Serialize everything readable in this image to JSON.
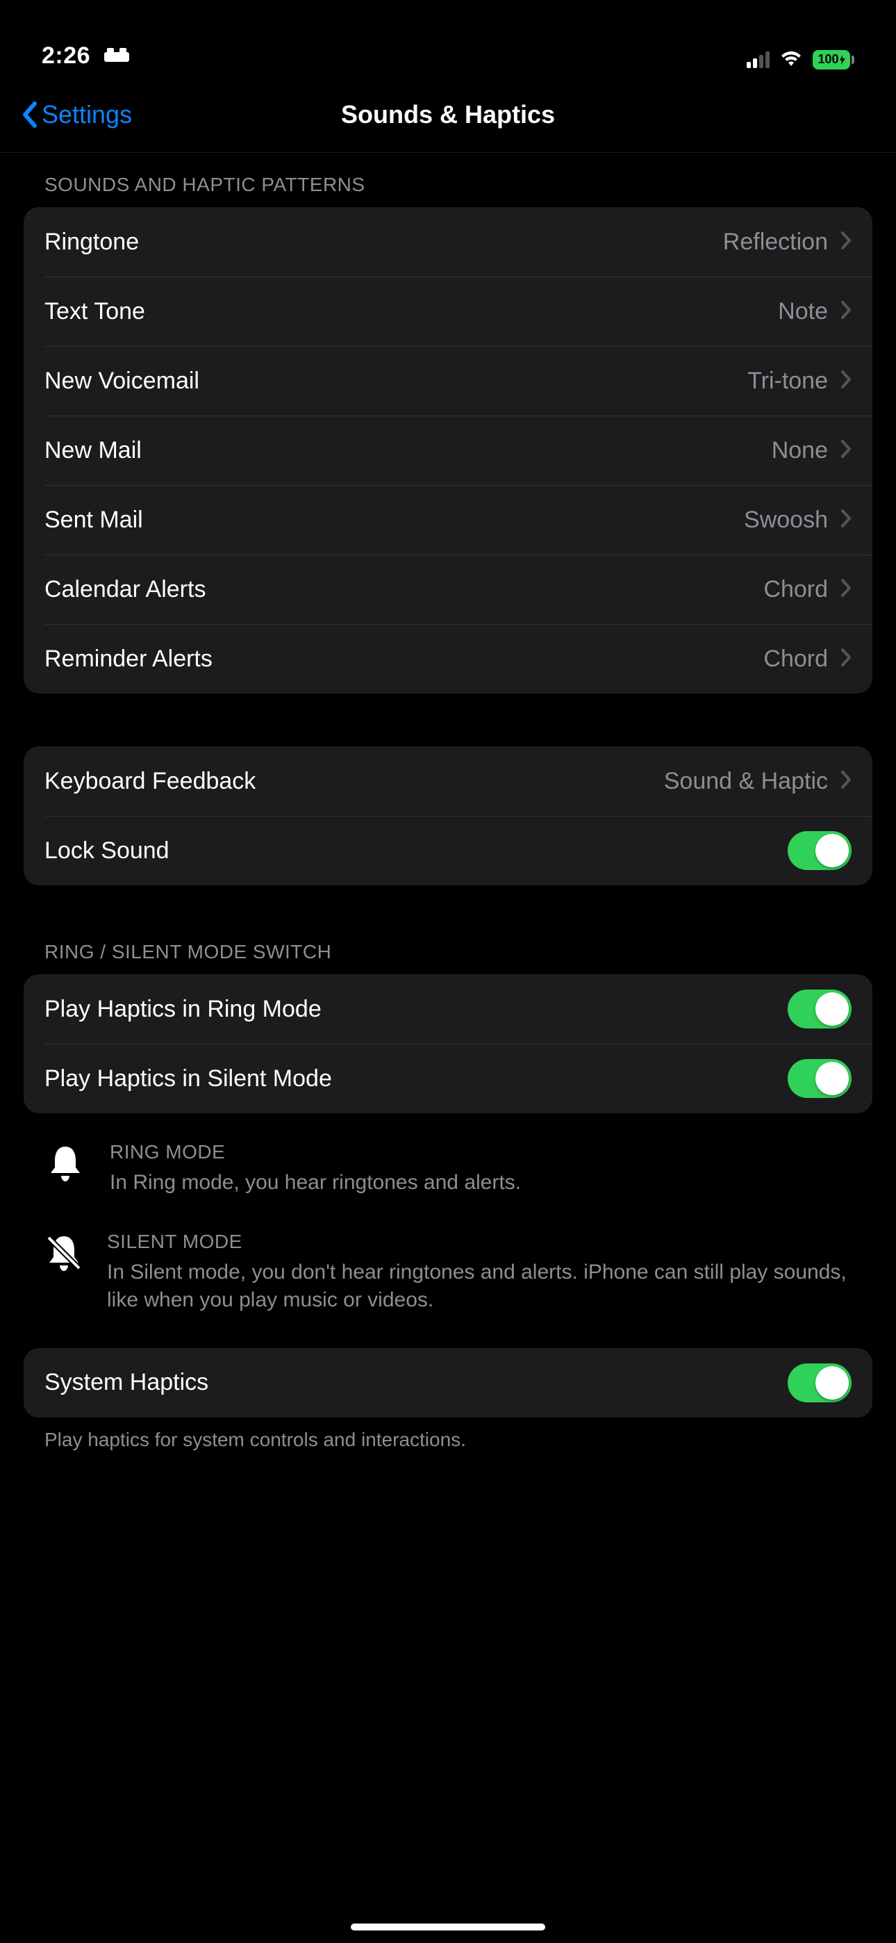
{
  "status": {
    "time": "2:26",
    "battery": "100"
  },
  "nav": {
    "back": "Settings",
    "title": "Sounds & Haptics"
  },
  "section1_header": "SOUNDS AND HAPTIC PATTERNS",
  "sounds": {
    "ringtone_label": "Ringtone",
    "ringtone_value": "Reflection",
    "text_tone_label": "Text Tone",
    "text_tone_value": "Note",
    "voicemail_label": "New Voicemail",
    "voicemail_value": "Tri-tone",
    "new_mail_label": "New Mail",
    "new_mail_value": "None",
    "sent_mail_label": "Sent Mail",
    "sent_mail_value": "Swoosh",
    "calendar_label": "Calendar Alerts",
    "calendar_value": "Chord",
    "reminder_label": "Reminder Alerts",
    "reminder_value": "Chord"
  },
  "keyboard_feedback_label": "Keyboard Feedback",
  "keyboard_feedback_value": "Sound & Haptic",
  "lock_sound_label": "Lock Sound",
  "section3_header": "RING / SILENT MODE SWITCH",
  "haptics_ring_label": "Play Haptics in Ring Mode",
  "haptics_silent_label": "Play Haptics in Silent Mode",
  "ring_mode_title": "RING MODE",
  "ring_mode_desc": "In Ring mode, you hear ringtones and alerts.",
  "silent_mode_title": "SILENT MODE",
  "silent_mode_desc": "In Silent mode, you don't hear ringtones and alerts. iPhone can still play sounds, like when you play music or videos.",
  "system_haptics_label": "System Haptics",
  "system_haptics_footer": "Play haptics for system controls and interactions."
}
